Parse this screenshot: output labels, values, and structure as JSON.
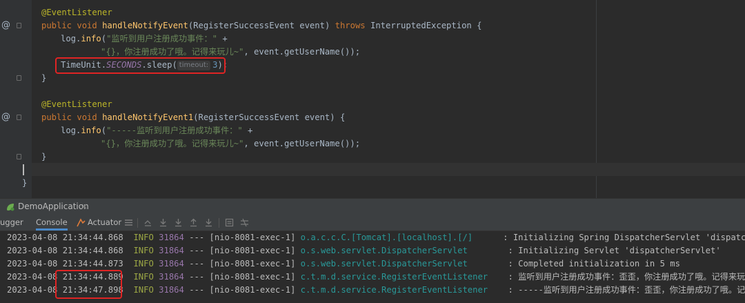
{
  "editor": {
    "lines": [
      {
        "annotation": "@EventListener"
      },
      {
        "kw1": "public",
        "kw2": "void",
        "name": "handleNotifyEvent",
        "params": "(RegisterSuccessEvent event) ",
        "throws": "throws",
        "exc": " InterruptedException {"
      },
      {
        "recv": "log.",
        "call": "info",
        "open": "(",
        "str": "\"监听到用户注册成功事件：\"",
        "tail": " +"
      },
      {
        "str": "\"{}，你注册成功了哦。记得来玩儿~\"",
        "tail": ", event.getUserName());"
      },
      {
        "cls": "TimeUnit.",
        "field": "SECONDS",
        "call": ".sleep(",
        "hint": "timeout:",
        "num": "3",
        "tail": ");"
      },
      {
        "text": "}"
      },
      {
        "annotation": "@EventListener"
      },
      {
        "kw1": "public",
        "kw2": "void",
        "name": "handleNotifyEvent1",
        "params": "(RegisterSuccessEvent event) {"
      },
      {
        "recv": "log.",
        "call": "info",
        "open": "(",
        "str": "\"-----监听到用户注册成功事件：\"",
        "tail": " +"
      },
      {
        "str": "\"{}，你注册成功了哦。记得来玩儿~\"",
        "tail": ", event.getUserName());"
      },
      {
        "text": "}"
      },
      {
        "text": "}"
      }
    ],
    "gutter_marker": "@"
  },
  "run_window": {
    "title": "DemoApplication",
    "close": "×",
    "tabs": [
      "ugger",
      "Console",
      "Actuator"
    ]
  },
  "console": {
    "lines": [
      {
        "ts": "2023-04-08 21:34:44.868",
        "level": "INFO",
        "pid": "31864",
        "sep": "---",
        "thread": "[nio-8081-exec-1]",
        "logger": "o.a.c.c.C.[Tomcat].[localhost].[/]     ",
        "msg": ": Initializing Spring DispatcherServlet 'dispatcherServlet'"
      },
      {
        "ts": "2023-04-08 21:34:44.868",
        "level": "INFO",
        "pid": "31864",
        "sep": "---",
        "thread": "[nio-8081-exec-1]",
        "logger": "o.s.web.servlet.DispatcherServlet       ",
        "msg": ": Initializing Servlet 'dispatcherServlet'"
      },
      {
        "ts": "2023-04-08 21:34:44.873",
        "level": "INFO",
        "pid": "31864",
        "sep": "---",
        "thread": "[nio-8081-exec-1]",
        "logger": "o.s.web.servlet.DispatcherServlet       ",
        "msg": ": Completed initialization in 5 ms"
      },
      {
        "ts": "2023-04-08 21:34:44.889",
        "level": "INFO",
        "pid": "31864",
        "sep": "---",
        "thread": "[nio-8081-exec-1]",
        "logger": "c.t.m.d.service.RegisterEventListener   ",
        "msg": ": 监听到用户注册成功事件：歪歪，你注册成功了哦。记得来玩儿~"
      },
      {
        "ts": "2023-04-08 21:34:47.898",
        "level": "INFO",
        "pid": "31864",
        "sep": "---",
        "thread": "[nio-8081-exec-1]",
        "logger": "c.t.m.d.service.RegisterEventListener   ",
        "msg": ": -----监听到用户注册成功事件：歪歪，你注册成功了哦。记得来玩儿~"
      }
    ]
  },
  "colors": {
    "editor_bg": "#2b2b2b",
    "keyword": "#cc7832",
    "annotation": "#bbb529",
    "string": "#6a8759",
    "method": "#ffc66d",
    "highlight_box": "#e02424"
  }
}
